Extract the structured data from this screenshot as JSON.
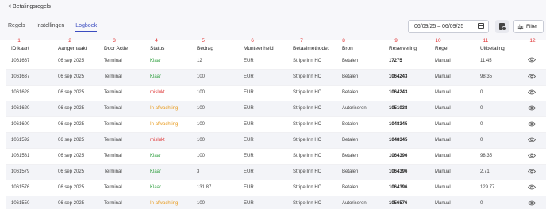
{
  "header": {
    "back_label": "< Betalingsregels",
    "tabs": [
      {
        "label": "Regels"
      },
      {
        "label": "Instellingen"
      },
      {
        "label": "Logboek"
      }
    ],
    "date_range": "06/09/25 – 06/09/25",
    "filter_label": "Filter"
  },
  "column_numbers": [
    "1",
    "2",
    "3",
    "4",
    "5",
    "6",
    "7",
    "8",
    "9",
    "10",
    "11",
    "12"
  ],
  "columns": [
    "ID kaart",
    "Aangemaakt",
    "Door Actie",
    "Status",
    "Bedrag",
    "Munteenheid",
    "Betaalmethode:",
    "Bron",
    "Reservering",
    "Regel",
    "Uitbetaling",
    ""
  ],
  "rows": [
    {
      "id": "1061667",
      "date": "06 sep 2025",
      "actor": "Terminal",
      "status": "Klaar",
      "status_type": "ok",
      "amount": "12",
      "currency": "EUR",
      "method": "Stripe Inn HC",
      "source": "Betalen",
      "reservation": "17275",
      "rule": "Manual",
      "payout": "11.45"
    },
    {
      "id": "1061637",
      "date": "06 sep 2025",
      "actor": "Terminal",
      "status": "Klaar",
      "status_type": "ok",
      "amount": "100",
      "currency": "EUR",
      "method": "Stripe Inn HC",
      "source": "Betalen",
      "reservation": "1064243",
      "rule": "Manual",
      "payout": "98.35"
    },
    {
      "id": "1061628",
      "date": "06 sep 2025",
      "actor": "Terminal",
      "status": "mislukt",
      "status_type": "fail",
      "amount": "100",
      "currency": "EUR",
      "method": "Stripe Inn HC",
      "source": "Betalen",
      "reservation": "1064243",
      "rule": "Manual",
      "payout": "0"
    },
    {
      "id": "1061620",
      "date": "06 sep 2025",
      "actor": "Terminal",
      "status": "In afwachting",
      "status_type": "wait",
      "amount": "100",
      "currency": "EUR",
      "method": "Stripe Inn HC",
      "source": "Autoriseren",
      "reservation": "1051038",
      "rule": "Manual",
      "payout": "0"
    },
    {
      "id": "1061600",
      "date": "06 sep 2025",
      "actor": "Terminal",
      "status": "In afwachting",
      "status_type": "wait",
      "amount": "100",
      "currency": "EUR",
      "method": "Stripe Inn HC",
      "source": "Betalen",
      "reservation": "1048345",
      "rule": "Manual",
      "payout": "0"
    },
    {
      "id": "1061592",
      "date": "06 sep 2025",
      "actor": "Terminal",
      "status": "mislukt",
      "status_type": "fail",
      "amount": "100",
      "currency": "EUR",
      "method": "Stripe Inn HC",
      "source": "Betalen",
      "reservation": "1048345",
      "rule": "Manual",
      "payout": "0"
    },
    {
      "id": "1061581",
      "date": "06 sep 2025",
      "actor": "Terminal",
      "status": "Klaar",
      "status_type": "ok",
      "amount": "100",
      "currency": "EUR",
      "method": "Stripe Inn HC",
      "source": "Betalen",
      "reservation": "1064396",
      "rule": "Manual",
      "payout": "98.35"
    },
    {
      "id": "1061579",
      "date": "06 sep 2025",
      "actor": "Terminal",
      "status": "Klaar",
      "status_type": "ok",
      "amount": "3",
      "currency": "EUR",
      "method": "Stripe Inn HC",
      "source": "Betalen",
      "reservation": "1064396",
      "rule": "Manual",
      "payout": "2.71"
    },
    {
      "id": "1061576",
      "date": "06 sep 2025",
      "actor": "Terminal",
      "status": "Klaar",
      "status_type": "ok",
      "amount": "131.87",
      "currency": "EUR",
      "method": "Stripe Inn HC",
      "source": "Betalen",
      "reservation": "1064396",
      "rule": "Manual",
      "payout": "129.77"
    },
    {
      "id": "1061550",
      "date": "06 sep 2025",
      "actor": "Terminal",
      "status": "In afwachting",
      "status_type": "wait",
      "amount": "100",
      "currency": "EUR",
      "method": "Stripe Inn HC",
      "source": "Autoriseren",
      "reservation": "1056576",
      "rule": "Manual",
      "payout": "0"
    }
  ],
  "colors": {
    "accent": "#3b4cc0",
    "ok": "#2e9e3e",
    "fail": "#e04040",
    "wait": "#e89a1c",
    "marker": "#e03030"
  }
}
